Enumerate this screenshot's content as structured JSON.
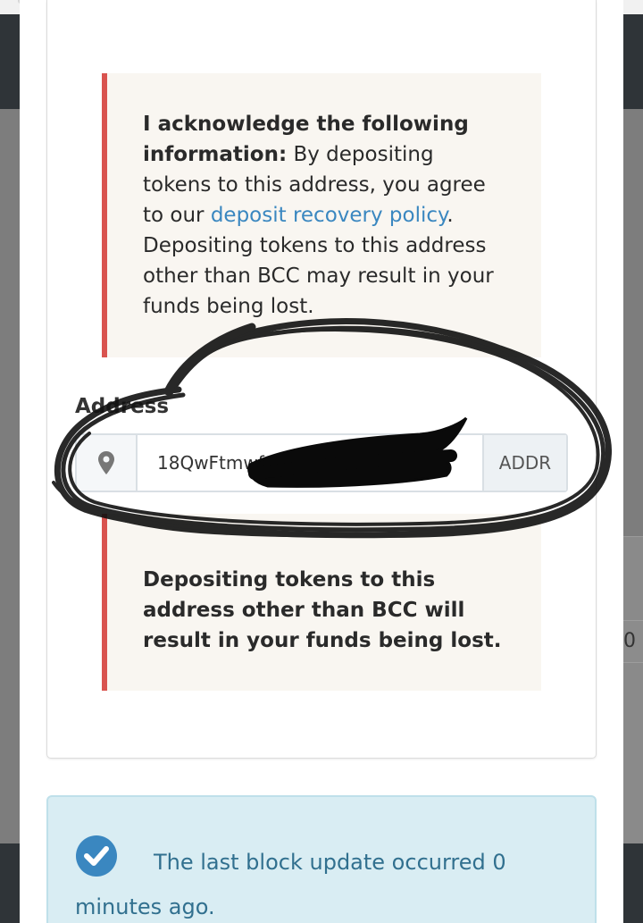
{
  "acknowledge": {
    "bold": "I acknowledge the following information:",
    "text_before_link": " By depositing tokens to this address, you agree to our ",
    "link": "deposit recovery policy",
    "text_after_link": ". Depositing tokens to this address other than BCC may result in your funds being lost."
  },
  "address": {
    "label": "Address",
    "value": "18QwFtmwf",
    "addon_button": "ADDR",
    "icon": "map-marker-icon"
  },
  "warning": {
    "text": "Depositing tokens to this address other than BCC will result in your funds being lost."
  },
  "status": {
    "icon": "check-circle-icon",
    "text": "The last block update occurred 0 minutes ago."
  },
  "background": {
    "partial_value": "0"
  },
  "colors": {
    "danger_border": "#d9534f",
    "link": "#3a87c0",
    "info_bg": "#d9edf3",
    "info_text": "#31708f",
    "check_icon": "#3a87c0"
  }
}
